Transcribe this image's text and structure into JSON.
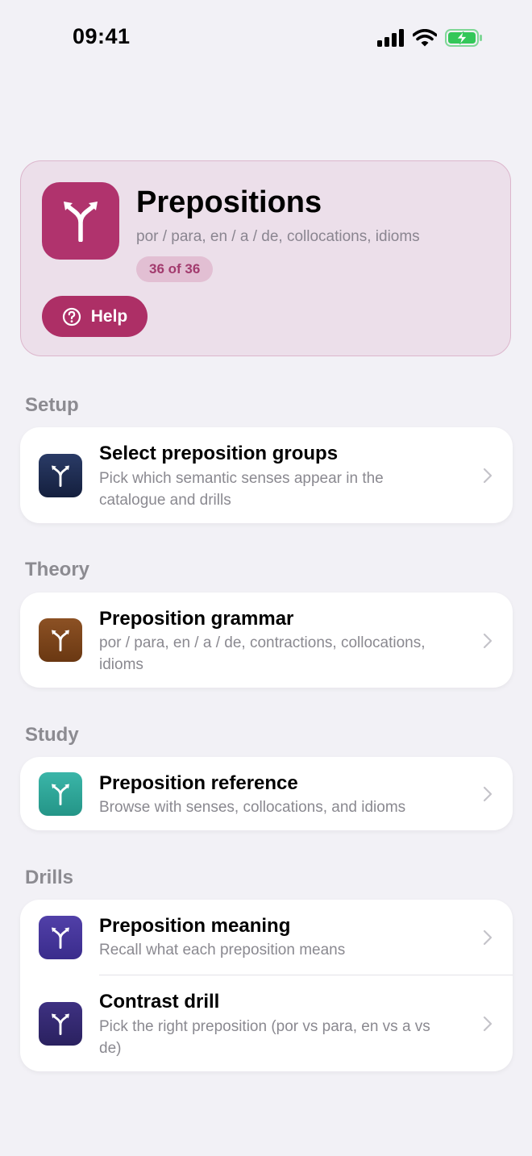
{
  "status_bar": {
    "time": "09:41",
    "icons": [
      "cellular-signal-icon",
      "wifi-icon",
      "battery-charging-icon"
    ],
    "battery_color": "#34c759"
  },
  "hero": {
    "icon": "fork-arrow-icon",
    "title": "Prepositions",
    "subtitle": "por / para, en / a / de, collocations, idioms",
    "count_badge": "36 of 36",
    "help_label": "Help",
    "accent": "#b0336d"
  },
  "sections": [
    {
      "header": "Setup",
      "rows": [
        {
          "title": "Select preposition groups",
          "subtitle": "Pick which semantic senses appear in the catalogue and drills",
          "icon_color": "#1c2a4f"
        }
      ]
    },
    {
      "header": "Theory",
      "rows": [
        {
          "title": "Preposition grammar",
          "subtitle": "por / para, en / a / de, contractions, collocations, idioms",
          "icon_color": "#7a431a"
        }
      ]
    },
    {
      "header": "Study",
      "rows": [
        {
          "title": "Preposition reference",
          "subtitle": "Browse with senses, collocations, and idioms",
          "icon_color": "#2fa599"
        }
      ]
    },
    {
      "header": "Drills",
      "rows": [
        {
          "title": "Preposition meaning",
          "subtitle": "Recall what each preposition means",
          "icon_color": "#43339a"
        },
        {
          "title": "Contrast drill",
          "subtitle": "Pick the right preposition (por vs para, en vs a vs de)",
          "icon_color": "#33296f"
        }
      ]
    }
  ]
}
